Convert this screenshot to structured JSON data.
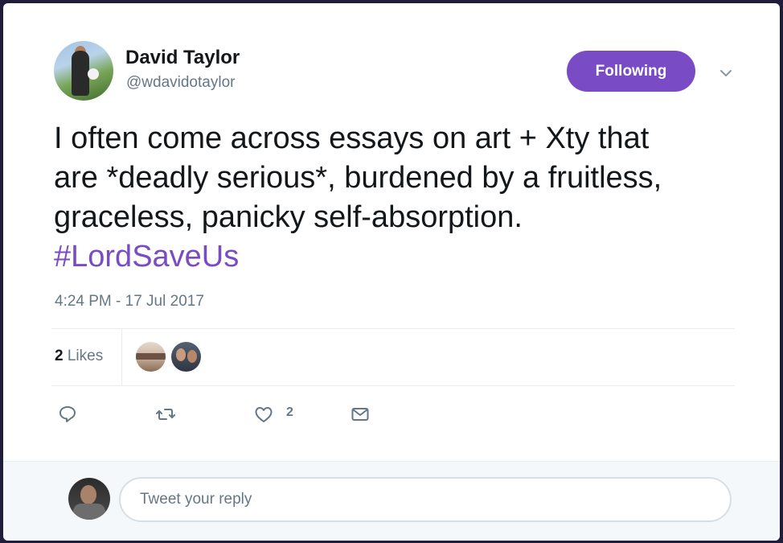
{
  "author": {
    "name": "David Taylor",
    "handle": "@wdavidotaylor"
  },
  "follow_button": {
    "label": "Following"
  },
  "tweet": {
    "text": "I often come across essays on art + Xty that\nare *deadly serious*, burdened by a fruitless,\ngraceless, panicky self-absorption.",
    "hashtag": "#LordSaveUs",
    "timestamp": "4:24 PM - 17 Jul 2017"
  },
  "stats": {
    "likes_count": "2",
    "likes_label": " Likes"
  },
  "actions": {
    "heart_count": "2",
    "icons": [
      "reply-icon",
      "retweet-icon",
      "heart-icon",
      "envelope-icon"
    ]
  },
  "reply": {
    "placeholder": "Tweet your reply"
  },
  "colors": {
    "accent": "#794bc4",
    "text": "#14171a",
    "muted": "#657786"
  }
}
